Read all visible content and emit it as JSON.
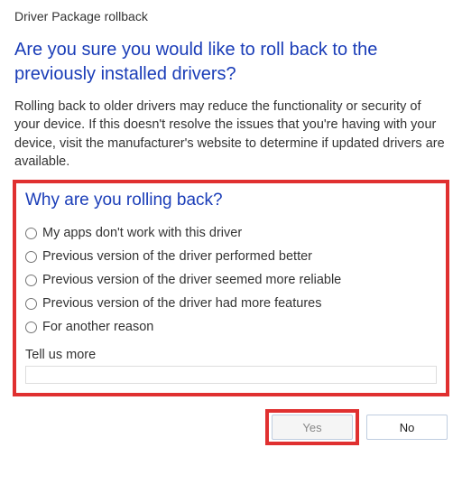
{
  "window": {
    "title": "Driver Package rollback"
  },
  "heading": "Are you sure you would like to roll back to the previously installed drivers?",
  "body": "Rolling back to older drivers may reduce the functionality or security of your device. If this doesn't resolve the issues that you're having with your device, visit the manufacturer's website to determine if updated drivers are available.",
  "subheading": "Why are you rolling back?",
  "reasons": [
    "My apps don't work with this driver",
    "Previous version of the driver performed better",
    "Previous version of the driver seemed more reliable",
    "Previous version of the driver had more features",
    "For another reason"
  ],
  "tell_more_label": "Tell us more",
  "tell_more_value": "",
  "buttons": {
    "yes": "Yes",
    "no": "No"
  },
  "highlights": {
    "reason_box": true,
    "yes_button": true
  }
}
